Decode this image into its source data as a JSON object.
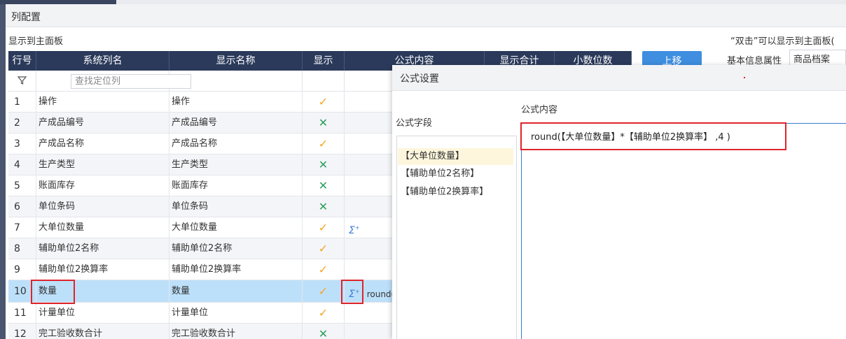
{
  "panel": {
    "title": "列配置"
  },
  "subheader": {
    "left": "显示到主面板",
    "right": "“双击”可以显示到主面板("
  },
  "grid": {
    "headers": {
      "idx": "行号",
      "sys": "系统列名",
      "disp": "显示名称",
      "show": "显示",
      "formula": "公式内容",
      "sum": "显示合计",
      "decimals": "小数位数"
    },
    "search_placeholder": "查找定位列",
    "rows": [
      {
        "idx": "1",
        "sys": "操作",
        "disp": "操作",
        "show": "✓",
        "formula": ""
      },
      {
        "idx": "2",
        "sys": "产成品编号",
        "disp": "产成品编号",
        "show": "✕",
        "formula": ""
      },
      {
        "idx": "3",
        "sys": "产成品名称",
        "disp": "产成品名称",
        "show": "✓",
        "formula": ""
      },
      {
        "idx": "4",
        "sys": "生产类型",
        "disp": "生产类型",
        "show": "✕",
        "formula": ""
      },
      {
        "idx": "5",
        "sys": "账面库存",
        "disp": "账面库存",
        "show": "✕",
        "formula": ""
      },
      {
        "idx": "6",
        "sys": "单位条码",
        "disp": "单位条码",
        "show": "✕",
        "formula": ""
      },
      {
        "idx": "7",
        "sys": "大单位数量",
        "disp": "大单位数量",
        "show": "✓",
        "formula": ""
      },
      {
        "idx": "8",
        "sys": "辅助单位2名称",
        "disp": "辅助单位2名称",
        "show": "✓",
        "formula": ""
      },
      {
        "idx": "9",
        "sys": "辅助单位2换算率",
        "disp": "辅助单位2换算率",
        "show": "✓",
        "formula": ""
      },
      {
        "idx": "10",
        "sys": "数量",
        "disp": "数量",
        "show": "✓",
        "formula": "round("
      },
      {
        "idx": "11",
        "sys": "计量单位",
        "disp": "计量单位",
        "show": "✓",
        "formula": ""
      },
      {
        "idx": "12",
        "sys": "完工验收数合计",
        "disp": "完工验收数合计",
        "show": "✕",
        "formula": ""
      }
    ]
  },
  "side": {
    "up_button": "上移",
    "basic_label": "基本信息属性",
    "basic_select": "商品档案"
  },
  "dialog": {
    "title": "公式设置",
    "fields_label": "公式字段",
    "fields": [
      "【大单位数量】",
      "【辅助单位2名称】",
      "【辅助单位2换算率】"
    ],
    "content_label": "公式内容",
    "formula": "round(【大单位数量】*【辅助单位2换算率】 ,4 )"
  },
  "colors": {
    "header_bg": "#2b3a5b",
    "selected_row": "#bde0fa",
    "check": "#f5a623",
    "cross": "#2e9e5c",
    "highlight_box": "#e0242b",
    "primary_button": "#3f8ee0"
  },
  "icons": {
    "filter": "filter-icon",
    "formula": "sigma-formula-icon"
  }
}
